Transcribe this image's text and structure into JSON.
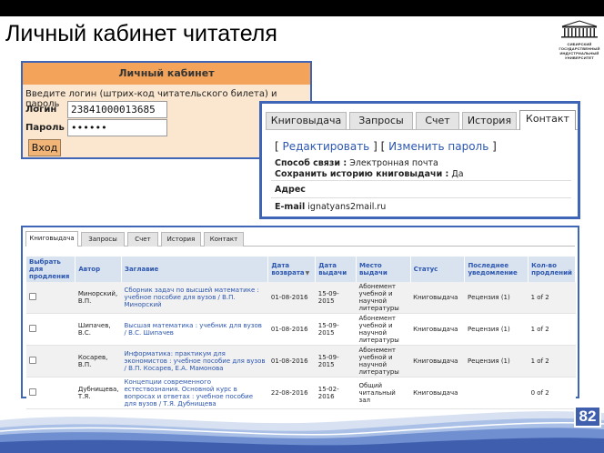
{
  "slide": {
    "title": "Личный кабинет читателя",
    "page_number": "82",
    "logo_lines": [
      "СИБИРСКИЙ",
      "ГОСУДАРСТВЕННЫЙ",
      "ИНДУСТРИАЛЬНЫЙ",
      "УНИВЕРСИТЕТ"
    ]
  },
  "login": {
    "header": "Личный кабинет",
    "hint": "Введите логин (штрих-код читательского билета) и пароль",
    "login_label": "Логин",
    "login_value": "23841000013685",
    "password_label": "Пароль",
    "password_value": "••••••",
    "submit_label": "Вход"
  },
  "contact": {
    "tabs": [
      "Книговыдача",
      "Запросы",
      "Счет",
      "История",
      "Контакт"
    ],
    "active_tab": "Контакт",
    "edit_link": "Редактировать",
    "change_password_link": "Изменить пароль",
    "contact_method_label": "Способ связи :",
    "contact_method_value": "Электронная почта",
    "save_history_label": "Сохранить историю книговыдачи :",
    "save_history_value": "Да",
    "address_label": "Адрес",
    "email_label": "E-mail",
    "email_value": "ignatyans2mail.ru"
  },
  "checkouts": {
    "tabs": [
      "Книговыдача",
      "Запросы",
      "Счет",
      "История",
      "Контакт"
    ],
    "active_tab": "Книговыдача",
    "columns": [
      "Выбрать для продления",
      "Автор",
      "Заглавие",
      "Дата возврата",
      "Дата выдачи",
      "Место выдачи",
      "Статус",
      "Последнее уведомление",
      "Кол-во продлений"
    ],
    "rows": [
      {
        "author": "Минорский, В.П.",
        "title": "Сборник задач по высшей математике : учебное пособие для вузов / В.П. Минорский",
        "due": "01-08-2016",
        "issued": "15-09-2015",
        "place": "Абонемент учебной и научной литературы",
        "status": "Книговыдача",
        "notice": "Рецензия (1)",
        "renewals": "1 of 2"
      },
      {
        "author": "Шипачев, В.С.",
        "title": "Высшая математика : учебник для вузов / В.С. Шипачев",
        "due": "01-08-2016",
        "issued": "15-09-2015",
        "place": "Абонемент учебной и научной литературы",
        "status": "Книговыдача",
        "notice": "Рецензия (1)",
        "renewals": "1 of 2"
      },
      {
        "author": "Косарев, В.П.",
        "title": "Информатика: практикум для экономистов : учебное пособие для вузов / В.П. Косарев, Е.А. Мамонова",
        "due": "01-08-2016",
        "issued": "15-09-2015",
        "place": "Абонемент учебной и научной литературы",
        "status": "Книговыдача",
        "notice": "Рецензия (1)",
        "renewals": "1 of 2"
      },
      {
        "author": "Дубнищева, Т.Я.",
        "title": "Концепции современного естествознания. Основной курс в вопросах и ответах : учебное пособие для вузов / Т.Я. Дубнищева",
        "due": "22-08-2016",
        "issued": "15-02-2016",
        "place": "Общий читальный зал",
        "status": "Книговыдача",
        "notice": "",
        "renewals": "0 of 2"
      }
    ]
  },
  "colors": {
    "accent_blue": "#3f66b6",
    "login_header": "#f4a45a",
    "login_bg": "#fbe7cf",
    "link_blue": "#2c56b0"
  }
}
